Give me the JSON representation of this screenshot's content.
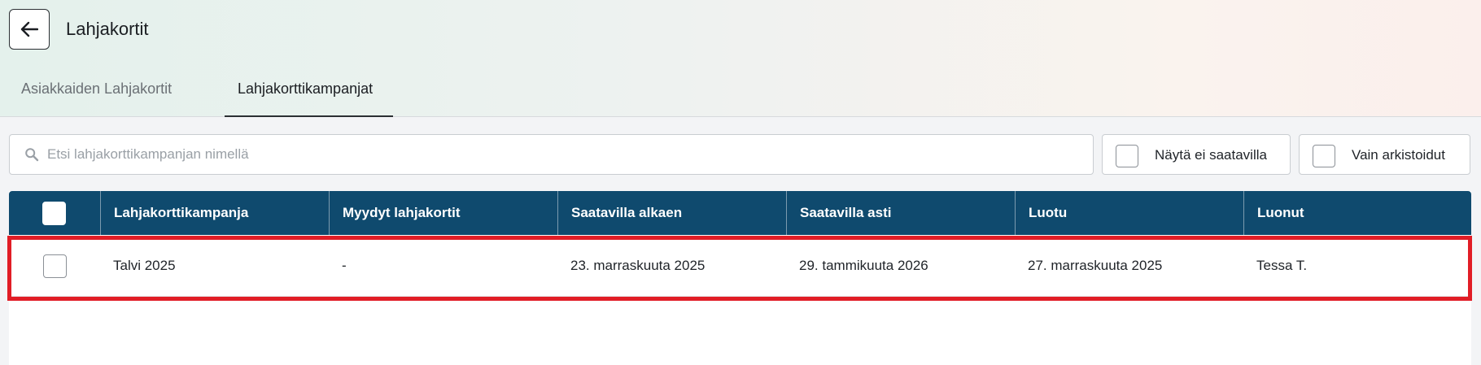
{
  "header": {
    "title": "Lahjakortit",
    "back_icon": "arrow-left-icon"
  },
  "tabs": [
    {
      "label": "Asiakkaiden Lahjakortit",
      "active": false
    },
    {
      "label": "Lahjakorttikampanjat",
      "active": true
    }
  ],
  "search": {
    "placeholder": "Etsi lahjakorttikampanjan nimellä",
    "value": "",
    "icon": "search-icon"
  },
  "filters": [
    {
      "label": "Näytä ei saatavilla",
      "checked": false
    },
    {
      "label": "Vain arkistoidut",
      "checked": false
    }
  ],
  "table": {
    "columns": [
      "Lahjakorttikampanja",
      "Myydyt lahjakortit",
      "Saatavilla alkaen",
      "Saatavilla asti",
      "Luotu",
      "Luonut"
    ],
    "rows": [
      {
        "checked": false,
        "cells": [
          "Talvi 2025",
          "-",
          "23. marraskuuta 2025",
          "29. tammikuuta 2026",
          "27. marraskuuta 2025",
          "Tessa T."
        ]
      }
    ]
  },
  "colors": {
    "table_header": "#0f4a6e",
    "highlight": "#e11d26"
  }
}
